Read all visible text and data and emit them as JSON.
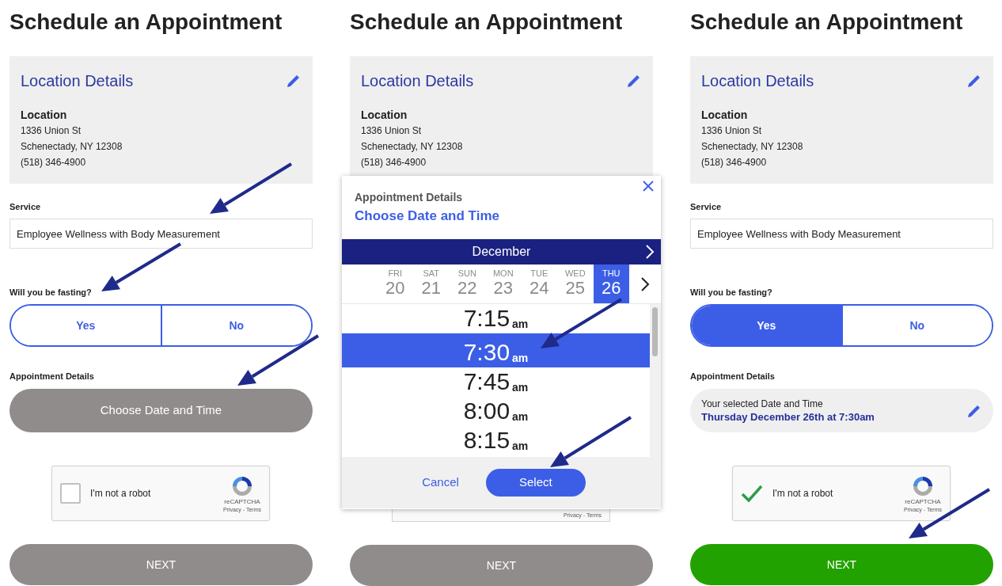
{
  "panels": [
    {
      "kind": "form",
      "title": "Schedule an Appointment",
      "location_card": {
        "title": "Location Details",
        "label": "Location",
        "lines": [
          "1336 Union St",
          "Schenectady, NY 12308",
          "(518) 346-4900"
        ]
      },
      "service": {
        "label": "Service",
        "value": "Employee Wellness with Body Measurement"
      },
      "fasting": {
        "label": "Will you be fasting?",
        "options": [
          {
            "label": "Yes",
            "selected": false
          },
          {
            "label": "No",
            "selected": false
          }
        ]
      },
      "appointment": {
        "label": "Appointment Details",
        "kind": "button",
        "button": "Choose Date and Time"
      },
      "captcha": {
        "label": "I'm not a robot",
        "checked": false,
        "brand": "reCAPTCHA",
        "links": "Privacy - Terms"
      },
      "next": {
        "label": "NEXT",
        "disabled": true
      }
    },
    {
      "kind": "picker",
      "title": "Schedule an Appointment",
      "location_card": {
        "title": "Location Details",
        "label": "Location",
        "lines": [
          "1336 Union St",
          "Schenectady, NY 12308",
          "(518) 346-4900"
        ]
      },
      "modal": {
        "subtitle": "Appointment Details",
        "title": "Choose Date and Time",
        "month": "December",
        "days": [
          {
            "weekday": "FRI",
            "date": "20",
            "selected": false
          },
          {
            "weekday": "SAT",
            "date": "21",
            "selected": false
          },
          {
            "weekday": "SUN",
            "date": "22",
            "selected": false
          },
          {
            "weekday": "MON",
            "date": "23",
            "selected": false
          },
          {
            "weekday": "TUE",
            "date": "24",
            "selected": false
          },
          {
            "weekday": "WED",
            "date": "25",
            "selected": false
          },
          {
            "weekday": "THU",
            "date": "26",
            "selected": true
          }
        ],
        "times": [
          {
            "time": "7:15",
            "suffix": "am",
            "selected": false
          },
          {
            "time": "7:30",
            "suffix": "am",
            "selected": true
          },
          {
            "time": "7:45",
            "suffix": "am",
            "selected": false
          },
          {
            "time": "8:00",
            "suffix": "am",
            "selected": false
          },
          {
            "time": "8:15",
            "suffix": "am",
            "selected": false
          }
        ],
        "cancel": "Cancel",
        "select": "Select"
      },
      "captcha": {
        "links": "Privacy - Terms"
      },
      "next": {
        "label": "NEXT",
        "disabled": true
      }
    },
    {
      "kind": "form",
      "title": "Schedule an Appointment",
      "location_card": {
        "title": "Location Details",
        "label": "Location",
        "lines": [
          "1336 Union St",
          "Schenectady, NY 12308",
          "(518) 346-4900"
        ]
      },
      "service": {
        "label": "Service",
        "value": "Employee Wellness with Body Measurement"
      },
      "fasting": {
        "label": "Will you be fasting?",
        "options": [
          {
            "label": "Yes",
            "selected": true
          },
          {
            "label": "No",
            "selected": false
          }
        ]
      },
      "appointment": {
        "label": "Appointment Details",
        "kind": "selected",
        "caption": "Your selected Date and Time",
        "value": "Thursday December 26th at 7:30am"
      },
      "captcha": {
        "label": "I'm not a robot",
        "checked": true,
        "brand": "reCAPTCHA",
        "links": "Privacy - Terms"
      },
      "next": {
        "label": "NEXT",
        "disabled": false
      }
    }
  ]
}
